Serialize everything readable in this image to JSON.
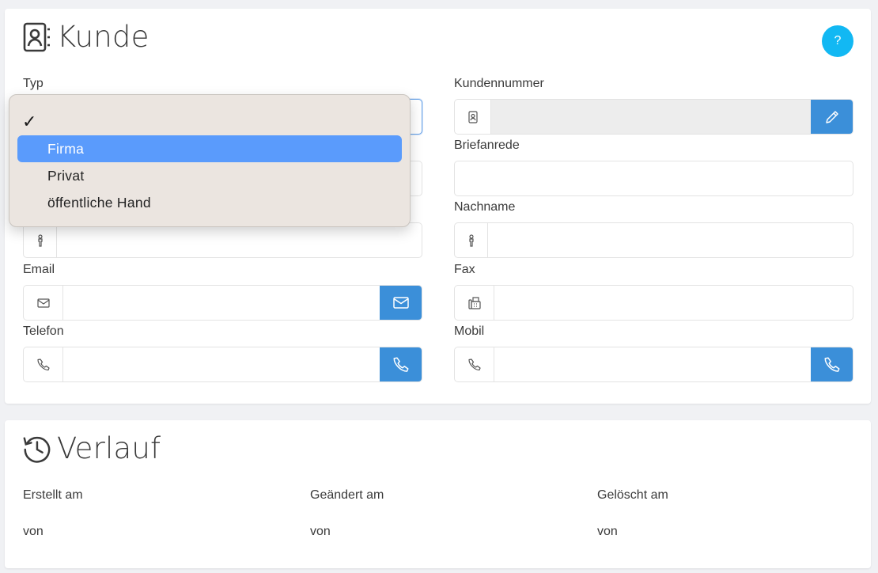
{
  "kunde": {
    "title": "Kunde",
    "help_label": "?",
    "fields": {
      "typ": {
        "label": "Typ",
        "value": ""
      },
      "kundennummer": {
        "label": "Kundennummer",
        "value": ""
      },
      "briefanrede": {
        "label": "Briefanrede",
        "value": ""
      },
      "nachname": {
        "label": "Nachname",
        "value": ""
      },
      "email": {
        "label": "Email",
        "value": ""
      },
      "fax": {
        "label": "Fax",
        "value": ""
      },
      "telefon": {
        "label": "Telefon",
        "value": ""
      },
      "mobil": {
        "label": "Mobil",
        "value": ""
      }
    }
  },
  "typ_dropdown": {
    "check_mark": "✓",
    "options": [
      {
        "label": ""
      },
      {
        "label": "Firma"
      },
      {
        "label": "Privat"
      },
      {
        "label": "öffentliche Hand"
      }
    ],
    "checked_index": 0,
    "highlighted_index": 1
  },
  "verlauf": {
    "title": "Verlauf",
    "columns": [
      {
        "label": "Erstellt am",
        "by_label": "von"
      },
      {
        "label": "Geändert am",
        "by_label": "von"
      },
      {
        "label": "Gelöscht am",
        "by_label": "von"
      }
    ]
  },
  "icons": {
    "kunde_title": "contact-book-icon",
    "verlauf_title": "history-icon",
    "kundennummer_addon": "contact-card-icon",
    "kundennummer_button": "pencil-icon",
    "name_addon": "person-icon",
    "email_addon": "envelope-icon",
    "email_button": "envelope-icon",
    "fax_addon": "fax-icon",
    "phone_addon": "phone-icon",
    "phone_button": "phone-icon"
  },
  "colors": {
    "accent": "#3b8fd9",
    "help_button": "#12b8f3",
    "dropdown_highlight": "#5a9bfc",
    "dropdown_bg": "#ebe5e0",
    "page_bg": "#f0f1f4"
  }
}
